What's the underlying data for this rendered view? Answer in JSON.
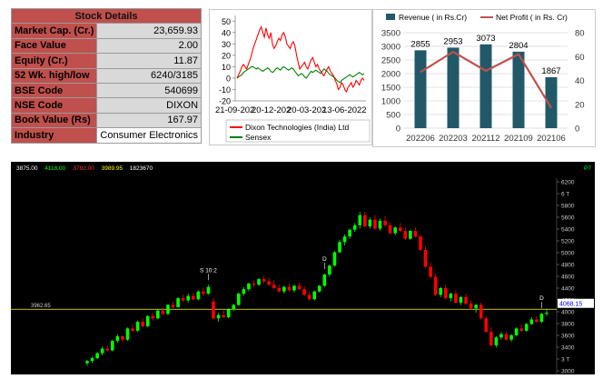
{
  "stock_details": {
    "title": "Stock Details",
    "rows": [
      {
        "label": "Market Cap. (Cr.)",
        "value": "23,659.93"
      },
      {
        "label": "Face Value",
        "value": "2.00"
      },
      {
        "label": "Equity (Cr.)",
        "value": "11.87"
      },
      {
        "label": "52 Wk. high/low",
        "value": "6240/3185"
      },
      {
        "label": "BSE Code",
        "value": "540699"
      },
      {
        "label": "NSE Code",
        "value": "DIXON"
      },
      {
        "label": "Book Value (Rs)",
        "value": "167.97"
      },
      {
        "label": "Industry",
        "value": "Consumer Electronics"
      }
    ],
    "colors": {
      "label_bg": "#c0504d",
      "value_bg": "#d9d9d9"
    }
  },
  "chart_data": [
    {
      "type": "line",
      "x_ticks": [
        "21-09-2021",
        "20-12-2021",
        "20-03-2022",
        "13-06-2022"
      ],
      "x_tick_display": [
        "21-09-202",
        "20-12-202",
        "20-03-202",
        "13-06-2022"
      ],
      "yticks": [
        -20,
        -10,
        0,
        10,
        20,
        30,
        40,
        50
      ],
      "ylim": [
        -20,
        55
      ],
      "series": [
        {
          "name": "Dixon Technologies (India) Ltd",
          "color": "#ff0000",
          "values": [
            0,
            3,
            6,
            10,
            12,
            10,
            8,
            12,
            16,
            20,
            26,
            30,
            34,
            38,
            42,
            45,
            40,
            36,
            44,
            38,
            35,
            40,
            30,
            26,
            28,
            32,
            35,
            33,
            38,
            40,
            36,
            30,
            28,
            26,
            30,
            32,
            28,
            20,
            14,
            8,
            10,
            12,
            14,
            10,
            8,
            12,
            16,
            18,
            14,
            10,
            12,
            8,
            6,
            4,
            2,
            5,
            8,
            10,
            6,
            4,
            2,
            -2,
            -5,
            -10,
            -8,
            -4,
            -6,
            -10,
            -12,
            -8,
            -6,
            -4,
            -8,
            -6,
            -2,
            -4,
            -6,
            -2,
            0,
            -2
          ]
        },
        {
          "name": "Sensex",
          "color": "#008000",
          "values": [
            0,
            1,
            2,
            3,
            5,
            6,
            7,
            8,
            9,
            10,
            10,
            9,
            8,
            9,
            8,
            7,
            6,
            7,
            8,
            9,
            8,
            6,
            5,
            6,
            8,
            9,
            8,
            7,
            9,
            10,
            9,
            8,
            7,
            8,
            9,
            8,
            6,
            4,
            2,
            3,
            4,
            3,
            1,
            0,
            2,
            4,
            6,
            5,
            6,
            7,
            6,
            5,
            4,
            6,
            8,
            7,
            6,
            4,
            3,
            2,
            1,
            0,
            -2,
            -3,
            -4,
            -2,
            -1,
            0,
            1,
            2,
            3,
            2,
            1,
            2,
            3,
            4,
            5,
            4,
            3,
            4
          ]
        }
      ]
    },
    {
      "type": "bar",
      "categories": [
        "202206",
        "202203",
        "202112",
        "202109",
        "202106"
      ],
      "series": [
        {
          "name": "Revenue ( in Rs.Cr)",
          "type": "bar",
          "color": "#215968",
          "values": [
            2855,
            2953,
            3073,
            2804,
            1867
          ]
        },
        {
          "name": "Net Profit ( in Rs. Cr)",
          "type": "line",
          "color": "#c0504d",
          "values": [
            47,
            64,
            48,
            62,
            17
          ]
        }
      ],
      "ylim_left": [
        0,
        3500
      ],
      "yticks_left": [
        0,
        500,
        1000,
        1500,
        2000,
        2500,
        3000,
        3500
      ],
      "ylim_right": [
        0,
        80
      ],
      "yticks_right": [
        0,
        20,
        40,
        60,
        80
      ],
      "legend_position": "top"
    },
    {
      "type": "candlestick",
      "header_values": [
        "3875.00",
        "4118.00",
        "3792.00",
        "3989.95",
        "1823670"
      ],
      "header_colors": [
        "#ffffff",
        "#00ff00",
        "#ff3333",
        "#ffff00",
        "#ffffff"
      ],
      "period_label": "P7",
      "yticks": [
        "6200",
        "6 T",
        "5800",
        "5600",
        "5400",
        "5200",
        "5000",
        "4800",
        "4600",
        "4400",
        "4200",
        "4000",
        "3800",
        "3600",
        "3400",
        "3 T",
        "3000"
      ],
      "ylim": [
        2800,
        6300
      ],
      "reference_line": {
        "label": "3962.65",
        "value": 3962.65,
        "color": "#ffff00"
      },
      "current_price": {
        "label": "4068.15",
        "value": 4068.15
      },
      "annotations": [
        {
          "text": "S 10:2",
          "index": 24
        },
        {
          "text": "D",
          "index": 47
        },
        {
          "text": "D",
          "index": 90
        }
      ],
      "candles": [
        [
          3000,
          3060,
          2950,
          3040
        ],
        [
          3040,
          3120,
          3000,
          3090
        ],
        [
          3090,
          3200,
          3070,
          3180
        ],
        [
          3180,
          3300,
          3140,
          3260
        ],
        [
          3260,
          3320,
          3200,
          3230
        ],
        [
          3230,
          3420,
          3210,
          3400
        ],
        [
          3400,
          3520,
          3360,
          3480
        ],
        [
          3480,
          3500,
          3380,
          3420
        ],
        [
          3420,
          3640,
          3400,
          3620
        ],
        [
          3620,
          3700,
          3560,
          3580
        ],
        [
          3580,
          3760,
          3560,
          3740
        ],
        [
          3740,
          3800,
          3640,
          3660
        ],
        [
          3660,
          3860,
          3640,
          3840
        ],
        [
          3840,
          3900,
          3760,
          3800
        ],
        [
          3800,
          3960,
          3780,
          3940
        ],
        [
          3940,
          3990,
          3860,
          3880
        ],
        [
          3880,
          4060,
          3860,
          4040
        ],
        [
          4040,
          4100,
          3980,
          4000
        ],
        [
          4000,
          4180,
          3990,
          4160
        ],
        [
          4160,
          4220,
          4090,
          4120
        ],
        [
          4120,
          4240,
          4080,
          4200
        ],
        [
          4200,
          4260,
          4120,
          4140
        ],
        [
          4140,
          4300,
          4120,
          4280
        ],
        [
          4280,
          4340,
          4200,
          4240
        ],
        [
          4240,
          4400,
          4220,
          4360
        ],
        [
          4100,
          4160,
          3780,
          3800
        ],
        [
          3800,
          3900,
          3740,
          3860
        ],
        [
          3860,
          3940,
          3800,
          3820
        ],
        [
          3820,
          3980,
          3800,
          3960
        ],
        [
          3960,
          4060,
          3930,
          4040
        ],
        [
          4040,
          4260,
          4020,
          4240
        ],
        [
          4240,
          4360,
          4200,
          4320
        ],
        [
          4320,
          4440,
          4280,
          4420
        ],
        [
          4420,
          4480,
          4360,
          4400
        ],
        [
          4400,
          4520,
          4380,
          4500
        ],
        [
          4500,
          4560,
          4420,
          4460
        ],
        [
          4460,
          4520,
          4380,
          4400
        ],
        [
          4400,
          4480,
          4320,
          4340
        ],
        [
          4340,
          4400,
          4260,
          4280
        ],
        [
          4280,
          4380,
          4240,
          4360
        ],
        [
          4360,
          4420,
          4280,
          4300
        ],
        [
          4300,
          4400,
          4260,
          4380
        ],
        [
          4380,
          4440,
          4300,
          4320
        ],
        [
          4320,
          4380,
          4200,
          4220
        ],
        [
          4220,
          4280,
          4120,
          4140
        ],
        [
          4140,
          4300,
          4120,
          4280
        ],
        [
          4280,
          4400,
          4260,
          4380
        ],
        [
          4380,
          4600,
          4360,
          4580
        ],
        [
          4580,
          4760,
          4540,
          4740
        ],
        [
          4740,
          5000,
          4720,
          4980
        ],
        [
          4980,
          5200,
          4960,
          5160
        ],
        [
          5160,
          5300,
          5100,
          5260
        ],
        [
          5260,
          5400,
          5220,
          5380
        ],
        [
          5380,
          5500,
          5340,
          5460
        ],
        [
          5460,
          5700,
          5400,
          5640
        ],
        [
          5640,
          5700,
          5420,
          5440
        ],
        [
          5440,
          5600,
          5400,
          5560
        ],
        [
          5560,
          5640,
          5380,
          5400
        ],
        [
          5400,
          5580,
          5360,
          5540
        ],
        [
          5540,
          5620,
          5420,
          5460
        ],
        [
          5460,
          5520,
          5300,
          5320
        ],
        [
          5320,
          5440,
          5280,
          5420
        ],
        [
          5420,
          5500,
          5340,
          5360
        ],
        [
          5360,
          5420,
          5200,
          5220
        ],
        [
          5220,
          5380,
          5200,
          5360
        ],
        [
          5360,
          5420,
          5240,
          5260
        ],
        [
          5260,
          5300,
          5000,
          5020
        ],
        [
          5020,
          5080,
          4700,
          4720
        ],
        [
          4720,
          4800,
          4520,
          4540
        ],
        [
          4540,
          4600,
          4200,
          4220
        ],
        [
          4220,
          4360,
          4180,
          4340
        ],
        [
          4340,
          4400,
          4140,
          4160
        ],
        [
          4160,
          4260,
          4100,
          4240
        ],
        [
          4240,
          4300,
          4060,
          4080
        ],
        [
          4080,
          4200,
          4040,
          4180
        ],
        [
          4180,
          4240,
          4040,
          4060
        ],
        [
          4060,
          4120,
          3960,
          3980
        ],
        [
          3980,
          4060,
          3900,
          4040
        ],
        [
          4040,
          4080,
          3780,
          3800
        ],
        [
          3800,
          3840,
          3540,
          3560
        ],
        [
          3560,
          3640,
          3300,
          3320
        ],
        [
          3320,
          3480,
          3280,
          3460
        ],
        [
          3460,
          3560,
          3420,
          3520
        ],
        [
          3520,
          3560,
          3400,
          3420
        ],
        [
          3420,
          3520,
          3380,
          3500
        ],
        [
          3500,
          3640,
          3480,
          3620
        ],
        [
          3620,
          3700,
          3560,
          3580
        ],
        [
          3580,
          3720,
          3560,
          3700
        ],
        [
          3700,
          3820,
          3680,
          3780
        ],
        [
          3780,
          3840,
          3720,
          3740
        ],
        [
          3740,
          3900,
          3720,
          3880
        ],
        [
          3880,
          3960,
          3840,
          3900
        ]
      ]
    }
  ]
}
